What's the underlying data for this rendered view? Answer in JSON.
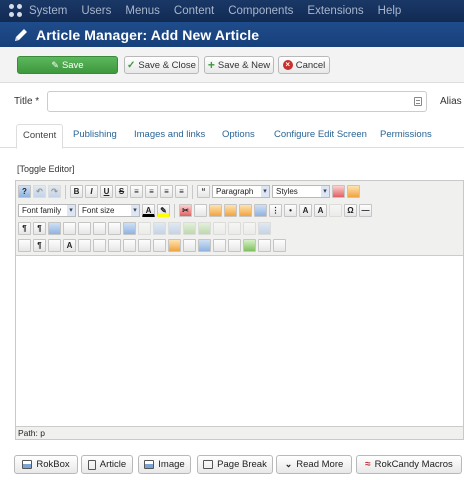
{
  "topnav": {
    "menus": [
      "System",
      "Users",
      "Menus",
      "Content",
      "Components",
      "Extensions",
      "Help"
    ]
  },
  "header": {
    "title": "Article Manager: Add New Article"
  },
  "toolbar": {
    "save": "Save",
    "save_close": "Save & Close",
    "save_new": "Save & New",
    "cancel": "Cancel"
  },
  "form": {
    "title_label": "Title *",
    "title_value": "",
    "alias_label": "Alias"
  },
  "tabs": [
    "Content",
    "Publishing",
    "Images and links",
    "Options",
    "Configure Edit Screen",
    "Permissions"
  ],
  "editor": {
    "toggle_label": "[Toggle Editor]",
    "format_select": "Paragraph",
    "styles_select": "Styles",
    "font_family_select": "Font family",
    "font_size_select": "Font size",
    "path_label": "Path:",
    "path_value": "p"
  },
  "buttons": {
    "rokbox": "RokBox",
    "article": "Article",
    "image": "Image",
    "page_break": "Page Break",
    "read_more": "Read More",
    "rokcandy": "RokCandy Macros"
  },
  "colors": {
    "nav_bg": "#1a3867",
    "header_bg": "#1f4c8c",
    "save_green": "#4cae4c",
    "link_blue": "#2a6496",
    "cancel_red": "#c9302c"
  }
}
